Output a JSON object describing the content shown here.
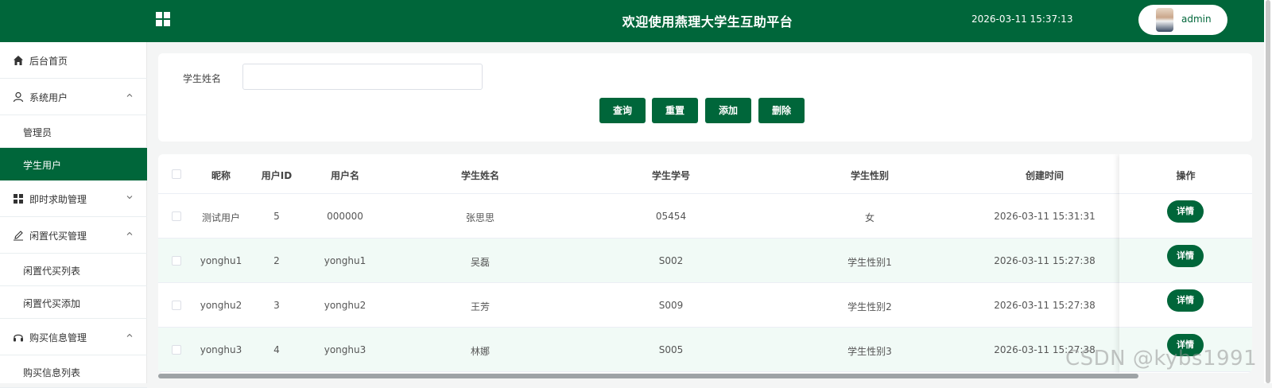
{
  "header": {
    "title": "欢迎使用燕理大学生互助平台",
    "datetime": "2026-03-11 15:37:13",
    "username": "admin"
  },
  "sidebar": {
    "home": "后台首页",
    "system_users": "系统用户",
    "admin": "管理员",
    "students": "学生用户",
    "help": "即时求助管理",
    "idle": "闲置代买管理",
    "idle_list": "闲置代买列表",
    "idle_add": "闲置代买添加",
    "purchase": "购买信息管理",
    "purchase_list": "购买信息列表"
  },
  "search": {
    "label": "学生姓名",
    "value": "",
    "buttons": {
      "query": "查询",
      "reset": "重置",
      "add": "添加",
      "delete": "删除"
    }
  },
  "table": {
    "columns": [
      "昵称",
      "用户ID",
      "用户名",
      "学生姓名",
      "学生学号",
      "学生性别",
      "创建时间",
      "操作"
    ],
    "rows": [
      [
        "测试用户",
        "5",
        "000000",
        "张思思",
        "05454",
        "女",
        "2026-03-11 15:31:31"
      ],
      [
        "yonghu1",
        "2",
        "yonghu1",
        "吴磊",
        "S002",
        "学生性别1",
        "2026-03-11 15:27:38"
      ],
      [
        "yonghu2",
        "3",
        "yonghu2",
        "王芳",
        "S009",
        "学生性别2",
        "2026-03-11 15:27:38"
      ],
      [
        "yonghu3",
        "4",
        "yonghu3",
        "林娜",
        "S005",
        "学生性别3",
        "2026-03-11 15:27:38"
      ]
    ],
    "detail_label": "详情"
  },
  "watermark": "CSDN @kybs1991",
  "colors": {
    "primary": "#00663a",
    "stripe": "#f1faf6"
  },
  "icons": [
    "grid-icon",
    "home-icon",
    "user-icon",
    "apps-icon",
    "pen-icon",
    "headset-icon",
    "chevron-up-icon",
    "chevron-down-icon"
  ]
}
